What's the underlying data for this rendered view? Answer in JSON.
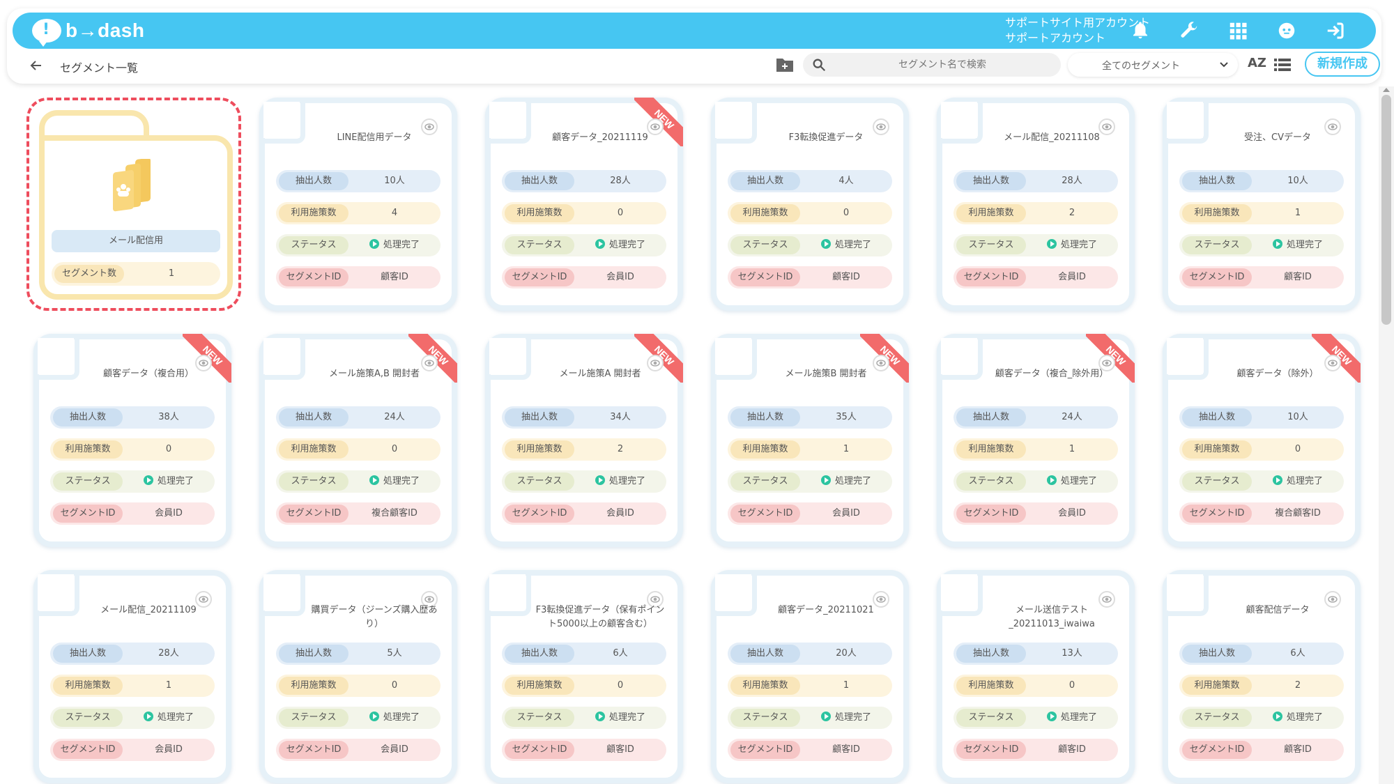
{
  "header": {
    "logo_text": "b→dash",
    "account_line1": "サポートサイト用アカウント",
    "account_line2": "サポートアカウント"
  },
  "subbar": {
    "title": "セグメント一覧",
    "search_placeholder": "セグメント名で検索",
    "filter_value": "全てのセグメント",
    "sort_label": "AZ",
    "new_button": "新規作成"
  },
  "labels": {
    "count": "抽出人数",
    "use": "利用施策数",
    "status": "ステータス",
    "segment_id": "セグメントID",
    "new_badge": "NEW",
    "status_done": "処理完了"
  },
  "folder": {
    "name": "メール配信用",
    "row_label": "セグメント数",
    "row_value": "1"
  },
  "cards": [
    {
      "title": "LINE配信用データ",
      "count": "10人",
      "use": "4",
      "status": "処理完了",
      "seg": "顧客ID",
      "is_new": false
    },
    {
      "title": "顧客データ_20211119",
      "count": "28人",
      "use": "0",
      "status": "処理完了",
      "seg": "会員ID",
      "is_new": true
    },
    {
      "title": "F3転換促進データ",
      "count": "4人",
      "use": "0",
      "status": "処理完了",
      "seg": "顧客ID",
      "is_new": false
    },
    {
      "title": "メール配信_20211108",
      "count": "28人",
      "use": "2",
      "status": "処理完了",
      "seg": "会員ID",
      "is_new": false
    },
    {
      "title": "受注、CVデータ",
      "count": "10人",
      "use": "1",
      "status": "処理完了",
      "seg": "顧客ID",
      "is_new": false
    },
    {
      "title": "顧客データ（複合用）",
      "count": "38人",
      "use": "0",
      "status": "処理完了",
      "seg": "会員ID",
      "is_new": true
    },
    {
      "title": "メール施策A,B 開封者",
      "count": "24人",
      "use": "0",
      "status": "処理完了",
      "seg": "複合顧客ID",
      "is_new": true
    },
    {
      "title": "メール施策A 開封者",
      "count": "34人",
      "use": "2",
      "status": "処理完了",
      "seg": "会員ID",
      "is_new": true
    },
    {
      "title": "メール施策B 開封者",
      "count": "35人",
      "use": "1",
      "status": "処理完了",
      "seg": "会員ID",
      "is_new": true
    },
    {
      "title": "顧客データ（複合_除外用）",
      "count": "24人",
      "use": "1",
      "status": "処理完了",
      "seg": "会員ID",
      "is_new": true
    },
    {
      "title": "顧客データ（除外）",
      "count": "10人",
      "use": "0",
      "status": "処理完了",
      "seg": "複合顧客ID",
      "is_new": true
    },
    {
      "title": "メール配信_20211109",
      "count": "28人",
      "use": "1",
      "status": "処理完了",
      "seg": "会員ID",
      "is_new": false
    },
    {
      "title": "購買データ（ジーンズ購入歴あり）",
      "count": "5人",
      "use": "0",
      "status": "処理完了",
      "seg": "会員ID",
      "is_new": false
    },
    {
      "title": "F3転換促進データ（保有ポイント5000以上の顧客含む）",
      "count": "6人",
      "use": "0",
      "status": "処理完了",
      "seg": "顧客ID",
      "is_new": false
    },
    {
      "title": "顧客データ_20211021",
      "count": "20人",
      "use": "1",
      "status": "処理完了",
      "seg": "顧客ID",
      "is_new": false
    },
    {
      "title": "メール送信テスト_20211013_iwaiwa",
      "count": "13人",
      "use": "0",
      "status": "処理完了",
      "seg": "顧客ID",
      "is_new": false
    },
    {
      "title": "顧客配信データ",
      "count": "6人",
      "use": "2",
      "status": "処理完了",
      "seg": "顧客ID",
      "is_new": false
    }
  ]
}
